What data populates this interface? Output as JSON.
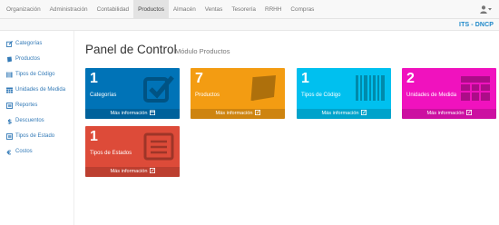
{
  "navbar": {
    "items": [
      {
        "label": "Organización"
      },
      {
        "label": "Administración"
      },
      {
        "label": "Contabilidad"
      },
      {
        "label": "Productos",
        "active": true
      },
      {
        "label": "Almacén"
      },
      {
        "label": "Ventas"
      },
      {
        "label": "Tesorería"
      },
      {
        "label": "RRHH"
      },
      {
        "label": "Compras"
      }
    ],
    "user_icon": "user-icon"
  },
  "brand": "ITS - DNCP",
  "sidebar": {
    "items": [
      {
        "label": "Categorías",
        "icon": "edit-icon"
      },
      {
        "label": "Productos",
        "icon": "book-icon"
      },
      {
        "label": "Tipos de Código",
        "icon": "barcode-icon"
      },
      {
        "label": "Unidades de Medida",
        "icon": "table-icon"
      },
      {
        "label": "Reportes",
        "icon": "list-icon"
      },
      {
        "label": "Descuentos",
        "icon": "dollar-icon"
      },
      {
        "label": "Tipos de Estado",
        "icon": "list-icon"
      },
      {
        "label": "Costos",
        "icon": "euro-icon"
      }
    ]
  },
  "header": {
    "title": "Panel de Control",
    "subtitle": "Módulo Productos"
  },
  "tiles": [
    {
      "count": "1",
      "label": "Categorías",
      "footer": "Más información",
      "color": "#0073b7",
      "icon": "check-square-icon"
    },
    {
      "count": "7",
      "label": "Productos",
      "footer": "Más información",
      "color": "#f39c12",
      "icon": "book-icon"
    },
    {
      "count": "1",
      "label": "Tipos de Código",
      "footer": "Más información",
      "color": "#00c0ef",
      "icon": "barcode-icon"
    },
    {
      "count": "2",
      "label": "Unidades de Medida",
      "footer": "Más información",
      "color": "#f012be",
      "icon": "table-icon"
    },
    {
      "count": "1",
      "label": "Tipos de Estados",
      "footer": "Más información",
      "color": "#dd4b39",
      "icon": "list-alt-icon"
    }
  ]
}
